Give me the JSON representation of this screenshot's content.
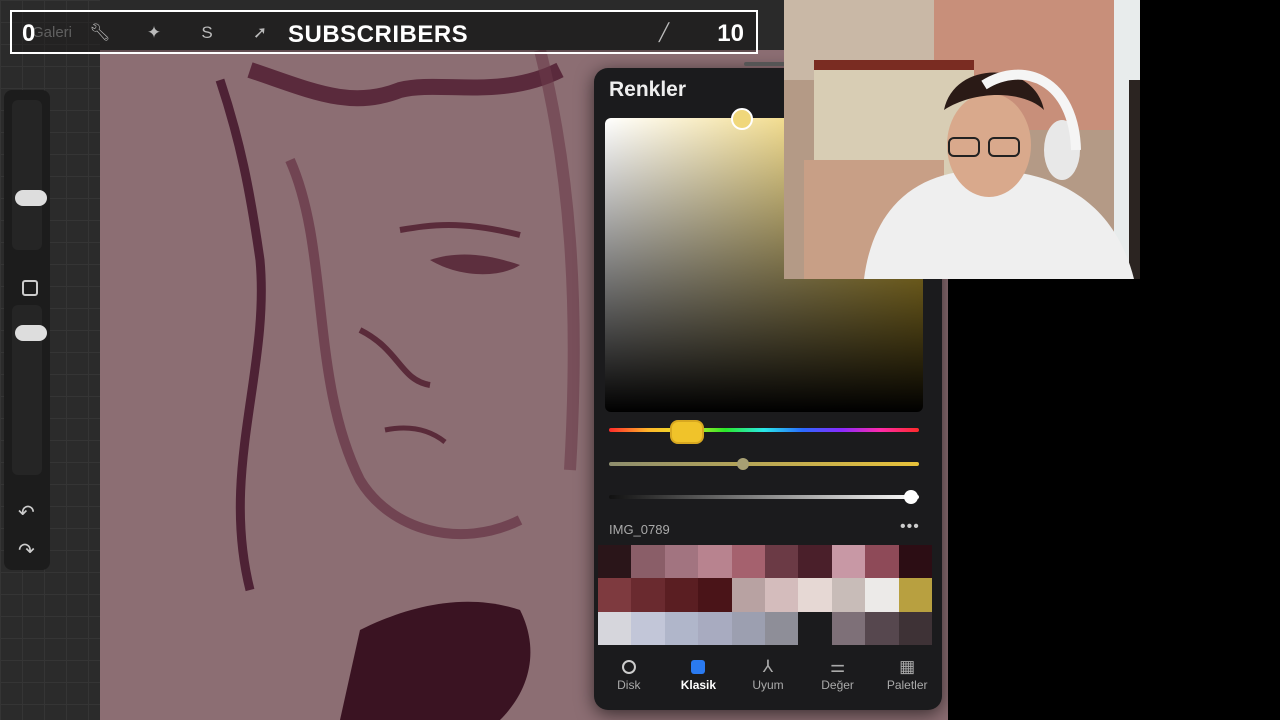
{
  "overlay": {
    "left_count": "0",
    "title": "SUBSCRIBERS",
    "right_count": "10",
    "gallery_label": "Galeri"
  },
  "color_panel": {
    "title": "Renkler",
    "palette_name": "IMG_0789",
    "more": "•••",
    "accent": "#f0c32a",
    "swatches": [
      "#2a1519",
      "#8a5e68",
      "#a27480",
      "#b8838f",
      "#a5616e",
      "#6b3a45",
      "#4a1f2a",
      "#c898a5",
      "#8e4a58",
      "#2c0d14",
      "#7e3a3f",
      "#6a2a2f",
      "#5a1e22",
      "#4a1418",
      "#b8a2a2",
      "#d4bcbc",
      "#e6d8d4",
      "#c8bcb8",
      "#eceae8",
      "#b8a040",
      "#d6d6dc",
      "#c2c6d8",
      "#b0b6ca",
      "#a8abc0",
      "#9c9fb0",
      "#8e8e98",
      "#1b1b1d",
      "#7e7078",
      "#56474e",
      "#3e3236"
    ],
    "tabs": [
      {
        "label": "Disk",
        "icon": "disk-icon"
      },
      {
        "label": "Klasik",
        "icon": "classic-icon"
      },
      {
        "label": "Uyum",
        "icon": "harmony-icon"
      },
      {
        "label": "Değer",
        "icon": "value-icon"
      },
      {
        "label": "Paletler",
        "icon": "palettes-icon"
      }
    ]
  }
}
